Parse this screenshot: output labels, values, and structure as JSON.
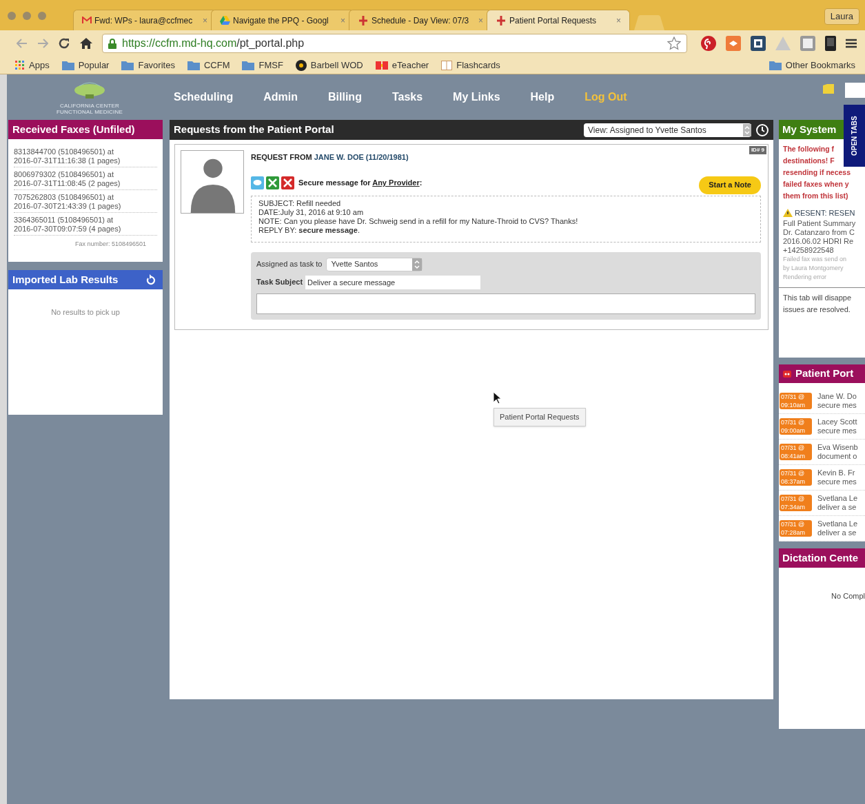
{
  "browser": {
    "tabs": [
      {
        "title": "Fwd: WPs - laura@ccfmec",
        "selected": false,
        "kind": "mail",
        "close": "×"
      },
      {
        "title": "Navigate the PPQ - Googl",
        "selected": false,
        "kind": "drive",
        "close": "×"
      },
      {
        "title": "Schedule - Day View: 07/3",
        "selected": false,
        "kind": "app",
        "close": "×"
      },
      {
        "title": "Patient Portal Requests",
        "selected": true,
        "kind": "app",
        "close": "×"
      }
    ],
    "profile": "Laura",
    "url_host": "https://ccfm.md-hq.com",
    "url_path": "/pt_portal.php",
    "bookmarks": [
      {
        "label": "Apps",
        "kind": "apps"
      },
      {
        "label": "Popular",
        "kind": "folder"
      },
      {
        "label": "Favorites",
        "kind": "folder"
      },
      {
        "label": "CCFM",
        "kind": "folder"
      },
      {
        "label": "FMSF",
        "kind": "folder"
      },
      {
        "label": "Barbell WOD",
        "kind": "circle"
      },
      {
        "label": "eTeacher",
        "kind": "flag"
      },
      {
        "label": "Flashcards",
        "kind": "page"
      }
    ],
    "other_bookmarks": "Other Bookmarks"
  },
  "logo": {
    "line1": "CALIFORNIA CENTER",
    "line2": "FUNCTIONAL MEDICINE"
  },
  "nav": [
    {
      "label": "Scheduling",
      "kind": "link"
    },
    {
      "label": "Admin",
      "kind": "link"
    },
    {
      "label": "Billing",
      "kind": "link"
    },
    {
      "label": "Tasks",
      "kind": "link"
    },
    {
      "label": "My Links",
      "kind": "link"
    },
    {
      "label": "Help",
      "kind": "link"
    },
    {
      "label": "Log Out",
      "kind": "logout"
    }
  ],
  "faxes": {
    "title": "Received Faxes (Unfiled)",
    "items": [
      {
        "line1": "8313844700 (5108496501) at",
        "line2": "2016-07-31T11:16:38 (1 pages)"
      },
      {
        "line1": "8006979302 (5108496501) at",
        "line2": "2016-07-31T11:08:45 (2 pages)"
      },
      {
        "line1": "7075262803 (5108496501) at",
        "line2": "2016-07-30T21:43:39 (1 pages)"
      },
      {
        "line1": "3364365011 (5108496501) at",
        "line2": "2016-07-30T09:07:59 (4 pages)"
      }
    ],
    "footer": "Fax number: 5108496501"
  },
  "labs": {
    "title": "Imported Lab Results",
    "empty": "No results to pick up"
  },
  "requests": {
    "title": "Requests from the Patient Portal",
    "view": "View: Assigned to Yvette Santos",
    "id_badge": "ID# 9",
    "heading": "REQUEST FROM ",
    "patient": "JANE W. DOE (11/20/1981)",
    "secure_prefix": "Secure message for ",
    "provider": "Any Provider",
    "secure_suffix": ":",
    "start_note": "Start a Note",
    "lines": [
      "SUBJECT: Refill needed",
      "DATE:July 31, 2016 at 9:10 am",
      "NOTE: Can you please have Dr. Schweig send in a refill for my Nature-Throid to CVS? Thanks!",
      "REPLY BY: **secure message**."
    ],
    "assigned_label": "Assigned as task to",
    "assignee": "Yvette Santos",
    "subject_label": "Task Subject",
    "subject_value": "Deliver a secure message"
  },
  "tooltip": "Patient Portal Requests",
  "open_tabs": "OPEN TABS",
  "my_system": {
    "title": "My System",
    "warning_lines": [
      "The following f",
      "destinations! F",
      "resending if necess",
      "failed faxes when y",
      "them from this list)"
    ],
    "resent_title": "RESENT: RESEN",
    "resent_lines": [
      "Full Patient Summary",
      "Dr. Catanzaro from C",
      "2016.06.02 HDRI Re",
      "+14258922548"
    ],
    "fail_lines": [
      "Failed fax was send on",
      "by Laura Montgomery",
      "Rendering error"
    ],
    "footer_lines": [
      "This tab will disappe",
      "issues are resolved."
    ]
  },
  "portal": {
    "title": "Patient Port",
    "items": [
      {
        "date": "07/31 @",
        "time": "09:10am",
        "name": "Jane W. Do",
        "detail": "secure mes"
      },
      {
        "date": "07/31 @",
        "time": "09:00am",
        "name": "Lacey Scott",
        "detail": "secure mes"
      },
      {
        "date": "07/31 @",
        "time": "08:41am",
        "name": "Eva Wisenb",
        "detail": "document o"
      },
      {
        "date": "07/31 @",
        "time": "08:37am",
        "name": "Kevin B. Fr",
        "detail": "secure mes"
      },
      {
        "date": "07/31 @",
        "time": "07:34am",
        "name": "Svetlana Le",
        "detail": "deliver a se"
      },
      {
        "date": "07/31 @",
        "time": "07:28am",
        "name": "Svetlana Le",
        "detail": "deliver a se"
      }
    ]
  },
  "dictation": {
    "title": "Dictation Cente",
    "empty": "No Compl"
  }
}
